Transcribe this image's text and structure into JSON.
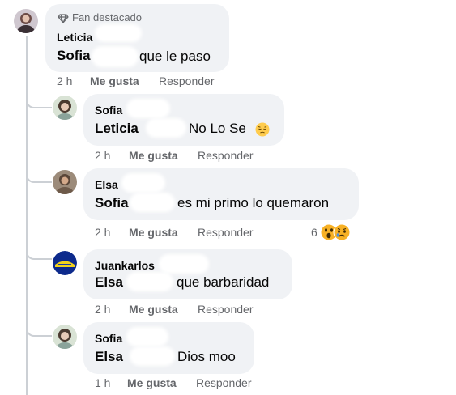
{
  "thread": {
    "top": {
      "badge_icon": "diamond-icon",
      "badge_label": "Fan destacado",
      "author": "Leticia",
      "mention": "Sofia",
      "text": "que le paso",
      "time": "2 h",
      "like": "Me gusta",
      "reply": "Responder"
    },
    "replies": [
      {
        "author": "Sofia",
        "mention": "Leticia",
        "text": "No Lo Se",
        "emoji": "pensive-face-emoji",
        "time": "2 h",
        "like": "Me gusta",
        "reply": "Responder"
      },
      {
        "author": "Elsa",
        "mention": "Sofia",
        "text": "es mi primo lo quemaron",
        "time": "2 h",
        "like": "Me gusta",
        "reply": "Responder",
        "reaction_count": "6",
        "reactions": [
          "wow",
          "sad"
        ]
      },
      {
        "author": "Juankarlos",
        "mention": "Elsa",
        "text": "que barbaridad",
        "time": "2 h",
        "like": "Me gusta",
        "reply": "Responder"
      },
      {
        "author": "Sofia",
        "mention": "Elsa",
        "text": "Dios moo",
        "time": "1 h",
        "like": "Me gusta",
        "reply": "Responder"
      }
    ]
  },
  "colors": {
    "bubble": "#f0f2f5",
    "secondary_text": "#65676b",
    "thread_line": "#ccd0d5"
  }
}
